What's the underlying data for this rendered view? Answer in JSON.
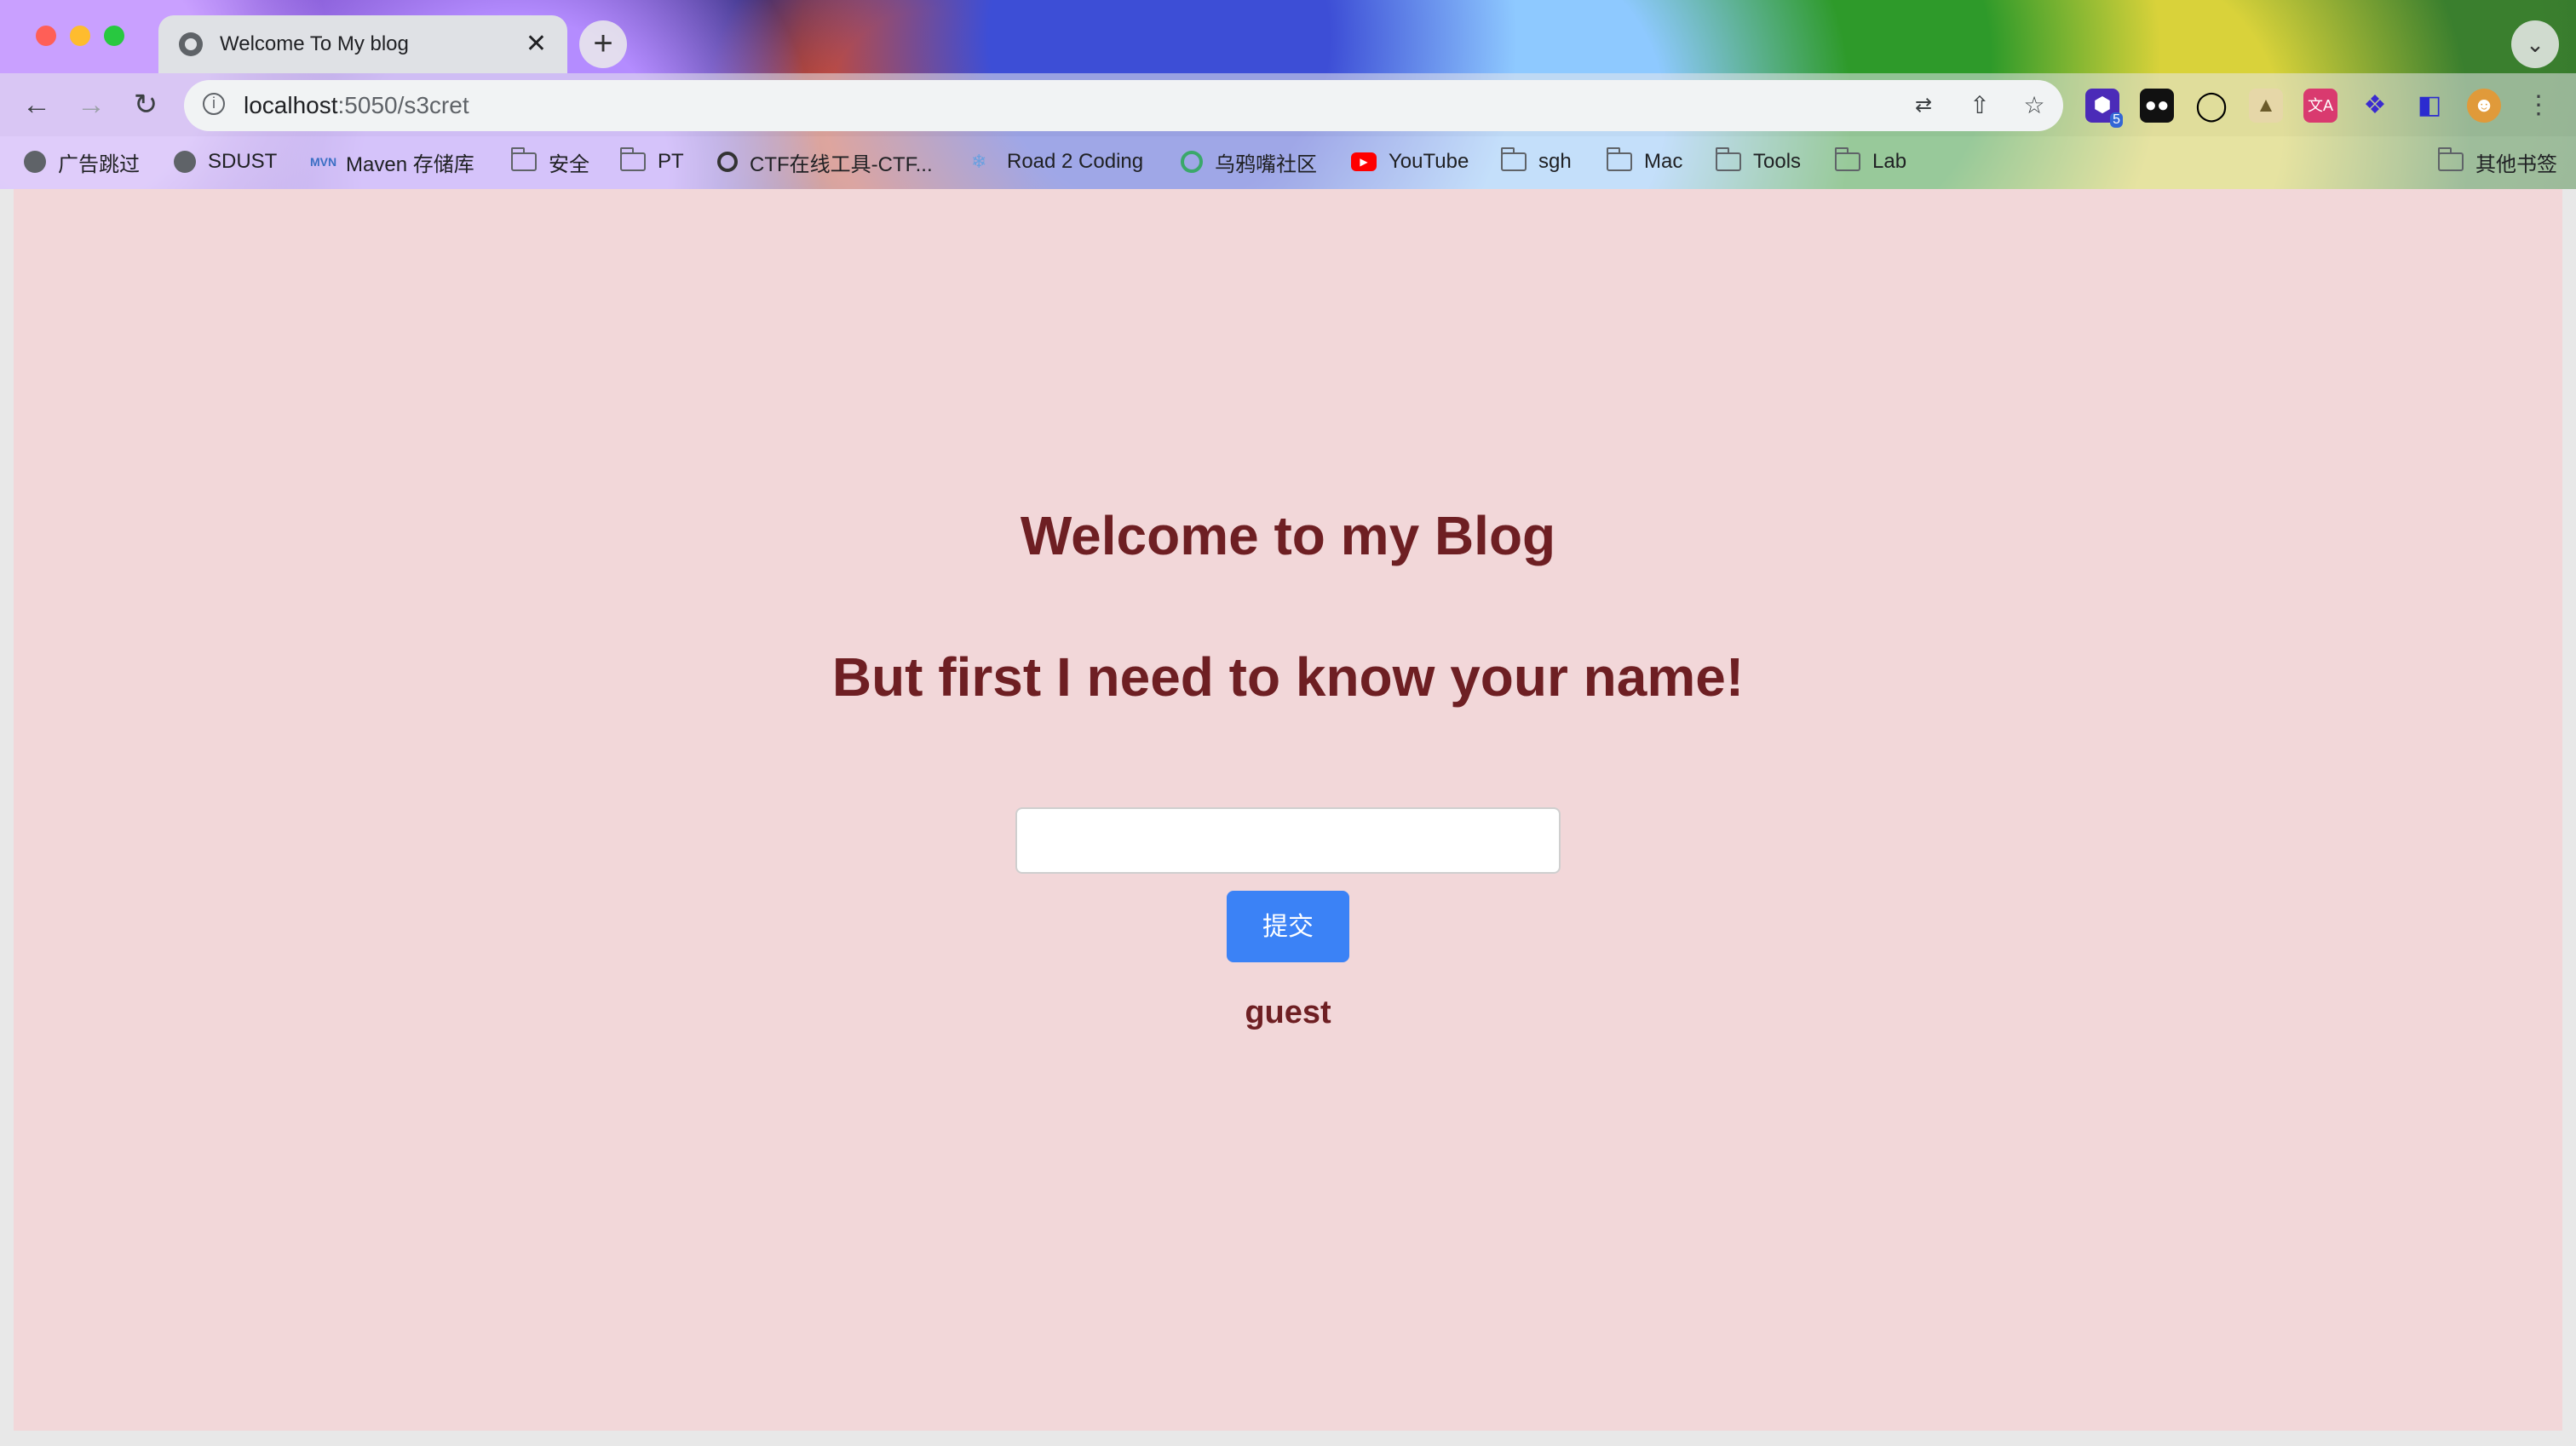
{
  "browser": {
    "tab_title": "Welcome To My blog",
    "tab_close": "✕",
    "new_tab": "+",
    "tab_menu": "⌄",
    "url_host": "localhost",
    "url_path": ":5050/s3cret",
    "extension_badge": "5"
  },
  "bookmarks": [
    {
      "label": "广告跳过",
      "icon": "globe-icon"
    },
    {
      "label": "SDUST",
      "icon": "globe-icon"
    },
    {
      "label": "Maven 存储库",
      "icon": "mvn-icon"
    },
    {
      "label": "安全",
      "icon": "folder-icon"
    },
    {
      "label": "PT",
      "icon": "folder-icon"
    },
    {
      "label": "CTF在线工具-CTF...",
      "icon": "ctf-icon"
    },
    {
      "label": "Road 2 Coding",
      "icon": "footprint-icon"
    },
    {
      "label": "乌鸦嘴社区",
      "icon": "crow-icon"
    },
    {
      "label": "YouTube",
      "icon": "youtube-icon"
    },
    {
      "label": "sgh",
      "icon": "folder-icon"
    },
    {
      "label": "Mac",
      "icon": "folder-icon"
    },
    {
      "label": "Tools",
      "icon": "folder-icon"
    },
    {
      "label": "Lab",
      "icon": "folder-icon"
    }
  ],
  "other_bookmarks": "其他书签",
  "page": {
    "heading": "Welcome to my Blog",
    "subheading": "But first I need to know your name!",
    "input_value": "",
    "submit_label": "提交",
    "current_name": "guest"
  },
  "colors": {
    "page_background": "#f2d7d9",
    "heading_color": "#6e1f23",
    "button_color": "#3b82f6"
  }
}
